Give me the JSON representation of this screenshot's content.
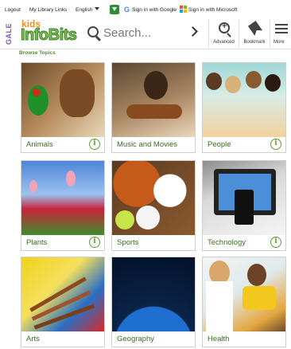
{
  "topbar": {
    "logout": "Logout",
    "my_library_links": "My Library Links",
    "language": "English",
    "google_signin": "Sign in with Google",
    "microsoft_signin": "Sign in with Microsoft"
  },
  "header": {
    "brand_prefix": "GALE",
    "logo_kids": "kids",
    "logo_name": "InfoBits",
    "search_placeholder": "Search...",
    "tools": [
      {
        "label": "Advanced",
        "icon": "advanced-search-icon"
      },
      {
        "label": "Bookmark",
        "icon": "bookmark-icon"
      },
      {
        "label": "More",
        "icon": "menu-icon"
      }
    ]
  },
  "browse_label": "Browse Topics",
  "topics": [
    {
      "label": "Animals",
      "image": "parrot-and-dog",
      "has_info": true
    },
    {
      "label": "Music and Movies",
      "image": "girl-playing-guitar",
      "has_info": false
    },
    {
      "label": "People",
      "image": "group-of-children",
      "has_info": true
    },
    {
      "label": "Plants",
      "image": "tulip-field",
      "has_info": true
    },
    {
      "label": "Sports",
      "image": "sports-balls",
      "has_info": false
    },
    {
      "label": "Technology",
      "image": "tablet-and-phone",
      "has_info": true
    },
    {
      "label": "Arts",
      "image": "paint-brushes",
      "has_info": false
    },
    {
      "label": "Geography",
      "image": "earth-from-space",
      "has_info": false
    },
    {
      "label": "Health",
      "image": "doctor-and-child",
      "has_info": false
    }
  ],
  "colors": {
    "brand_green": "#5f9e32",
    "caption_text": "#3b6e22",
    "logo_orange": "#f28c1e",
    "gale_purple": "#7a57b5"
  }
}
